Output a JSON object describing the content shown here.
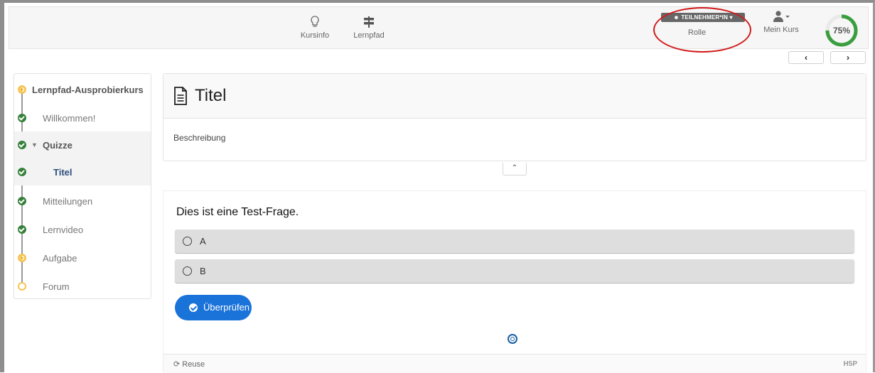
{
  "nav": {
    "kursinfo": "Kursinfo",
    "lernpfad": "Lernpfad",
    "role_value": "TEILNEHMER*IN",
    "role_label": "Rolle",
    "mein_kurs": "Mein Kurs",
    "progress": "75%",
    "progress_value": 0.75,
    "prev_label": "‹",
    "next_label": "›"
  },
  "sidebar": {
    "items": [
      {
        "label": "Lernpfad-Ausprobierkurs",
        "status": "in-progress"
      },
      {
        "label": "Willkommen!",
        "status": "done"
      },
      {
        "label": "Quizze",
        "status": "done"
      },
      {
        "label": "Titel",
        "status": "done"
      },
      {
        "label": "Mitteilungen",
        "status": "done"
      },
      {
        "label": "Lernvideo",
        "status": "done"
      },
      {
        "label": "Aufgabe",
        "status": "in-progress"
      },
      {
        "label": "Forum",
        "status": "not-started"
      }
    ]
  },
  "content": {
    "title": "Titel",
    "description": "Beschreibung"
  },
  "quiz": {
    "question": "Dies ist eine Test-Frage.",
    "answers": [
      "A",
      "B"
    ],
    "check_label": "Überprüfen",
    "reuse_label": "Reuse",
    "logo": "H5P"
  },
  "colors": {
    "accent": "#1a73d9",
    "done": "#35803a",
    "in_progress": "#f6c452",
    "annotation": "#d11a1a"
  }
}
